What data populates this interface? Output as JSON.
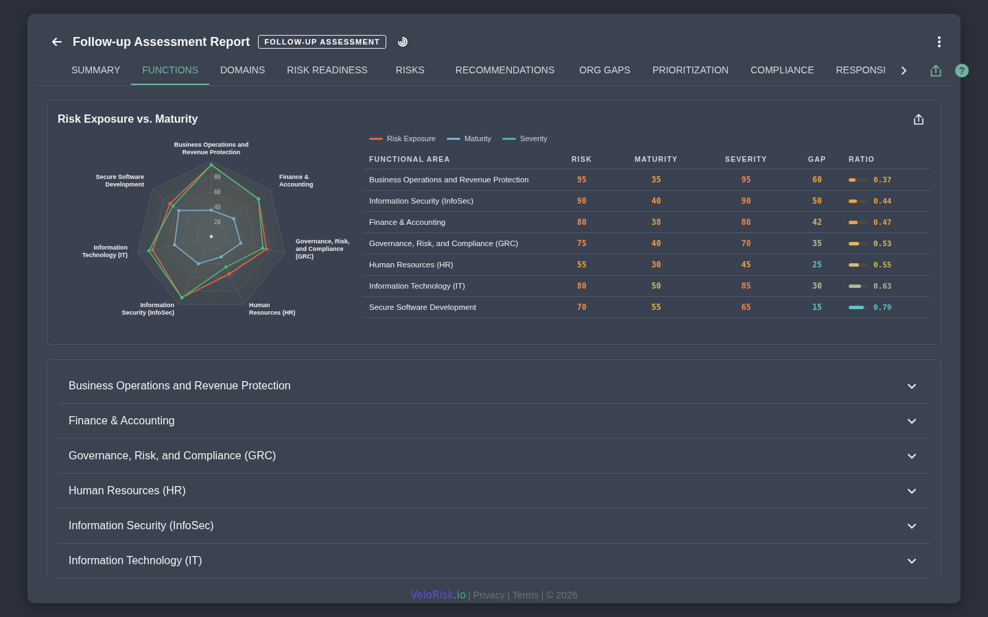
{
  "header": {
    "title": "Follow-up Assessment Report",
    "badge": "FOLLOW-UP ASSESSMENT",
    "help_icon": "?"
  },
  "tabs": [
    {
      "label": "SUMMARY",
      "selected": false
    },
    {
      "label": "FUNCTIONS",
      "selected": true
    },
    {
      "label": "DOMAINS",
      "selected": false
    },
    {
      "label": "RISK READINESS",
      "selected": false
    },
    {
      "label": "RISKS",
      "selected": false
    },
    {
      "label": "RECOMMENDATIONS",
      "selected": false
    },
    {
      "label": "ORG GAPS",
      "selected": false
    },
    {
      "label": "PRIORITIZATION",
      "selected": false
    },
    {
      "label": "COMPLIANCE",
      "selected": false
    },
    {
      "label": "RESPONSI",
      "selected": false
    }
  ],
  "chart_card": {
    "title": "Risk Exposure vs. Maturity",
    "chart_data": {
      "type": "radar",
      "categories": [
        "Business Operations and Revenue Protection",
        "Finance & Accounting",
        "Governance, Risk, and Compliance (GRC)",
        "Human Resources (HR)",
        "Information Security (InfoSec)",
        "Information Technology (IT)",
        "Secure Software Development"
      ],
      "ylim": [
        0,
        100
      ],
      "yticks": [
        20,
        40,
        60,
        80
      ],
      "series": [
        {
          "name": "Risk Exposure",
          "color": "#e8643c",
          "values": [
            95,
            80,
            75,
            55,
            90,
            80,
            70
          ]
        },
        {
          "name": "Maturity",
          "color": "#7aaede",
          "values": [
            35,
            38,
            40,
            30,
            40,
            50,
            55
          ]
        },
        {
          "name": "Severity",
          "color": "#3fbf7f",
          "values": [
            95,
            80,
            70,
            45,
            90,
            85,
            65
          ]
        }
      ]
    },
    "table": {
      "columns": [
        "FUNCTIONAL AREA",
        "RISK",
        "MATURITY",
        "SEVERITY",
        "GAP",
        "RATIO"
      ],
      "rows": [
        {
          "area": "Business Operations and Revenue Protection",
          "risk": "95",
          "maturity": "35",
          "severity": "95",
          "gap": "60",
          "level": 0.37,
          "ratio": "0.37"
        },
        {
          "area": "Information Security (InfoSec)",
          "risk": "90",
          "maturity": "40",
          "severity": "90",
          "gap": "50",
          "level": 0.44,
          "ratio": "0.44"
        },
        {
          "area": "Finance & Accounting",
          "risk": "80",
          "maturity": "38",
          "severity": "80",
          "gap": "42",
          "level": 0.47,
          "ratio": "0.47"
        },
        {
          "area": "Governance, Risk, and Compliance (GRC)",
          "risk": "75",
          "maturity": "40",
          "severity": "70",
          "gap": "35",
          "level": 0.53,
          "ratio": "0.53"
        },
        {
          "area": "Human Resources (HR)",
          "risk": "55",
          "maturity": "30",
          "severity": "45",
          "gap": "25",
          "level": 0.55,
          "ratio": "0.55"
        },
        {
          "area": "Information Technology (IT)",
          "risk": "80",
          "maturity": "50",
          "severity": "85",
          "gap": "30",
          "level": 0.63,
          "ratio": "0.63"
        },
        {
          "area": "Secure Software Development",
          "risk": "70",
          "maturity": "55",
          "severity": "65",
          "gap": "15",
          "level": 0.79,
          "ratio": "0.79"
        }
      ]
    }
  },
  "sections": [
    {
      "title": "Business Operations and Revenue Protection",
      "expanded": false
    },
    {
      "title": "Finance & Accounting",
      "expanded": false
    },
    {
      "title": "Governance, Risk, and Compliance (GRC)",
      "expanded": false
    },
    {
      "title": "Human Resources (HR)",
      "expanded": false
    },
    {
      "title": "Information Security (InfoSec)",
      "expanded": false
    },
    {
      "title": "Information Technology (IT)",
      "expanded": false
    }
  ],
  "footer": {
    "brand": "VeloRisk",
    "brand_suffix": ".io",
    "text": "| Privacy | Terms | © 2026"
  }
}
